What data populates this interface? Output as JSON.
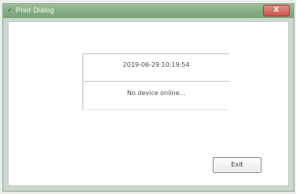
{
  "window": {
    "title": "Print Dialog",
    "close_label": "X"
  },
  "panel": {
    "datetime": "2019-06-29 10:19:54",
    "status": "No device online..."
  },
  "buttons": {
    "exit_label": "Exit"
  },
  "icons": {
    "app": "app-icon",
    "close": "close-icon"
  }
}
